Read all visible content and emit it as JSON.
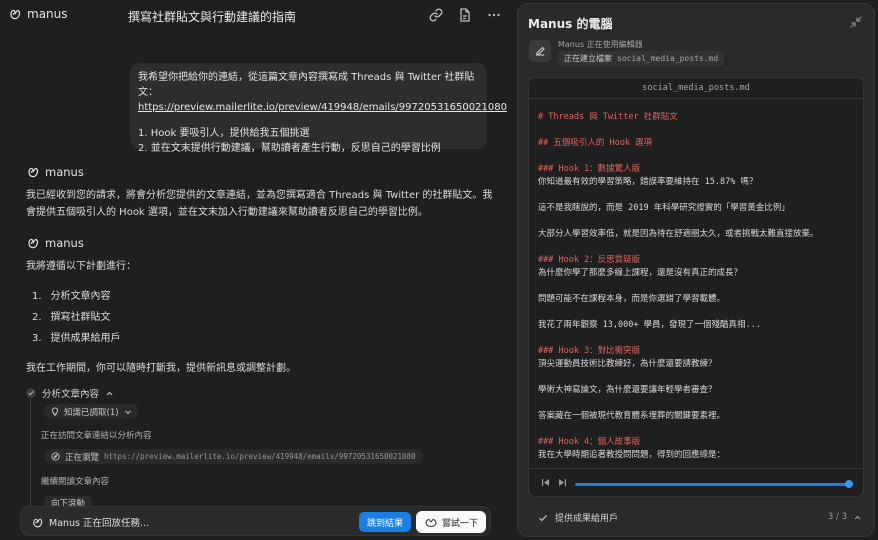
{
  "app": {
    "brand": "manus",
    "task_title": "撰寫社群貼文與行動建議的指南"
  },
  "user_message": {
    "line1": "我希望你把給你的連結，從這篇文章內容撰寫成 Threads 與 Twitter 社群貼文：",
    "link": "https://preview.mailerlite.io/preview/419948/emails/99720531650021080",
    "req1": "1. Hook 要吸引人，提供給我五個挑選",
    "req2": "2. 並在文末提供行動建議，幫助讀者產生行動，反思自己的學習比例"
  },
  "agent": {
    "name": "manus",
    "reply1": "我已經收到您的請求，將會分析您提供的文章連結，並為您撰寫適合 Threads 與 Twitter 的社群貼文。我會提供五個吸引人的 Hook 選項，並在文末加入行動建議來幫助讀者反思自己的學習比例。",
    "plan_intro": "我將遵循以下計劃進行：",
    "plan": [
      {
        "num": "1.",
        "text": "分析文章內容"
      },
      {
        "num": "2.",
        "text": "撰寫社群貼文"
      },
      {
        "num": "3.",
        "text": "提供成果給用戶"
      }
    ],
    "plan_outro": "我在工作期間，你可以隨時打斷我，提供新訊息或調整計劃。"
  },
  "step": {
    "title": "分析文章內容",
    "knowledge_pill": "知識已調取(1)",
    "visiting_text": "正在訪問文章連結以分析內容",
    "browsing_label": "正在瀏覽",
    "browsing_url": "https://preview.mailerlite.io/preview/419948/emails/99720531650021080",
    "continue_text": "繼續閱讀文章內容",
    "scroll_pill": "向下滾動"
  },
  "bottom_bar": {
    "status": "Manus 正在回放任務...",
    "jump_button": "跳到結果",
    "try_button": "嘗試一下"
  },
  "computer": {
    "title": "Manus 的電腦",
    "using": "Manus 正在使用編輯器",
    "action": "正在建立檔案",
    "action_file": "social_media_posts.md",
    "file_name": "social_media_posts.md",
    "lines": [
      {
        "text": "# Threads 與 Twitter 社群貼文",
        "style": "red"
      },
      {
        "text": "",
        "style": ""
      },
      {
        "text": "## 五個吸引人的 Hook 選項",
        "style": "red"
      },
      {
        "text": "",
        "style": ""
      },
      {
        "text": "### Hook 1：數據驚人版",
        "style": "red"
      },
      {
        "text": "你知道最有效的學習策略，錯誤率要維持在 15.87% 嗎？",
        "style": ""
      },
      {
        "text": "",
        "style": ""
      },
      {
        "text": "這不是我瞎說的，而是 2019 年科學研究證實的「學習黃金比例」",
        "style": ""
      },
      {
        "text": "",
        "style": ""
      },
      {
        "text": "大部分人學習效率低，就是因為待在舒適圈太久，或者挑戰太難直接放棄。",
        "style": ""
      },
      {
        "text": "",
        "style": ""
      },
      {
        "text": "### Hook 2：反思質疑版",
        "style": "red"
      },
      {
        "text": "為什麼你學了那麼多線上課程，還是沒有真正的成長？",
        "style": ""
      },
      {
        "text": "",
        "style": ""
      },
      {
        "text": "問題可能不在課程本身，而是你選錯了學習載體。",
        "style": ""
      },
      {
        "text": "",
        "style": ""
      },
      {
        "text": "我花了兩年觀察 13,000+ 學員，發現了一個殘酷真相...",
        "style": ""
      },
      {
        "text": "",
        "style": ""
      },
      {
        "text": "### Hook 3：對比衝突版",
        "style": "red"
      },
      {
        "text": "頂尖運動員技術比教練好，為什麼還要請教練？",
        "style": ""
      },
      {
        "text": "",
        "style": ""
      },
      {
        "text": "學術大神寫論文，為什麼還要讓年輕學者審查？",
        "style": ""
      },
      {
        "text": "",
        "style": ""
      },
      {
        "text": "答案藏在一個被現代教育體系埋葬的關鍵要素裡。",
        "style": ""
      },
      {
        "text": "",
        "style": ""
      },
      {
        "text": "### Hook 4：個人故事版",
        "style": "red"
      },
      {
        "text": "我在大學時期追著教授問問題，得到的回應總是：",
        "style": ""
      }
    ],
    "progress": 0.98,
    "footer_step": "提供成果給用戶",
    "footer_count": "3 / 3"
  }
}
